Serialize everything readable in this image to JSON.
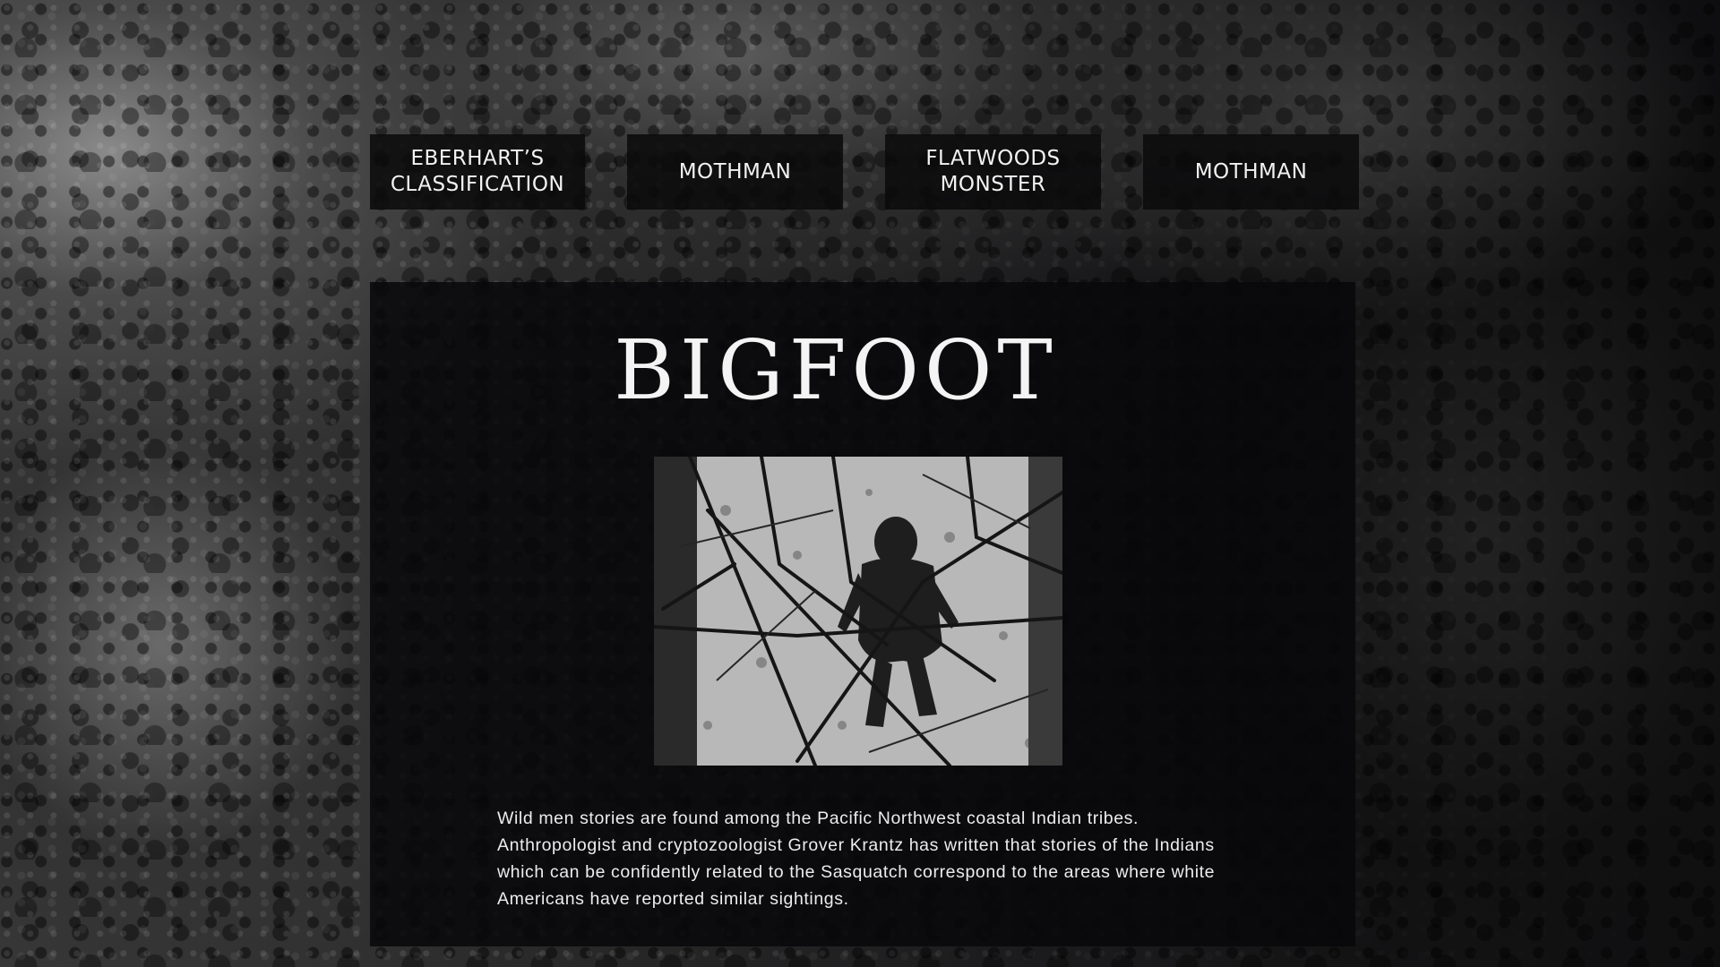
{
  "nav": {
    "items": [
      {
        "label": "EBERHART’S\nCLASSIFICATION"
      },
      {
        "label": "MOTHMAN"
      },
      {
        "label": "FLATWOODS\nMONSTER"
      },
      {
        "label": "MOTHMAN"
      }
    ]
  },
  "article": {
    "title": "BIGFOOT",
    "description": "Wild men stories are found among the Pacific Northwest coastal Indian tribes. Anthropologist and cryptozoologist Grover Krantz has written that stories of the Indians which can be confidently related to the Sasquatch correspond to the areas where white Americans have reported similar sightings."
  },
  "colors": {
    "panel": "#0a0a0c",
    "text": "#f2f2f2"
  }
}
